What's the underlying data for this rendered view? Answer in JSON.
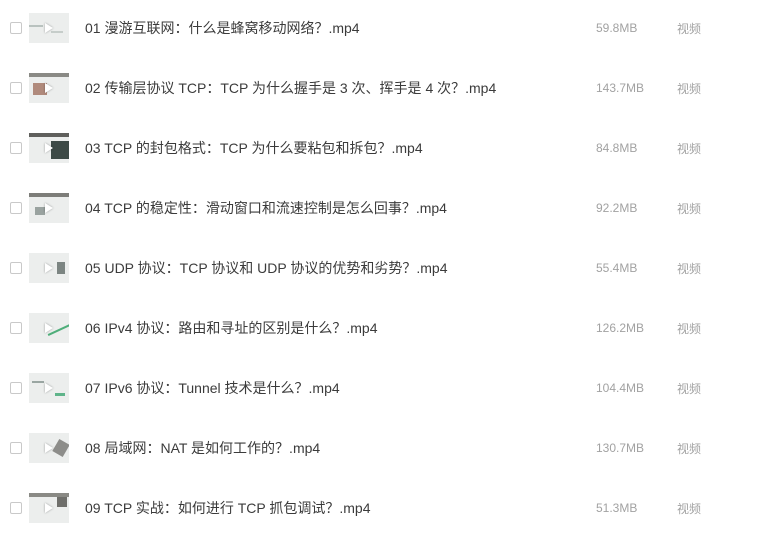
{
  "files": [
    {
      "title": "01 漫游互联网：什么是蜂窝移动网络？.mp4",
      "size": "59.8MB",
      "type": "视频"
    },
    {
      "title": "02 传输层协议 TCP：TCP 为什么握手是 3 次、挥手是 4 次？.mp4",
      "size": "143.7MB",
      "type": "视频"
    },
    {
      "title": "03 TCP 的封包格式：TCP 为什么要粘包和拆包？.mp4",
      "size": "84.8MB",
      "type": "视频"
    },
    {
      "title": "04 TCP 的稳定性：滑动窗口和流速控制是怎么回事？.mp4",
      "size": "92.2MB",
      "type": "视频"
    },
    {
      "title": "05 UDP 协议：TCP 协议和 UDP 协议的优势和劣势？.mp4",
      "size": "55.4MB",
      "type": "视频"
    },
    {
      "title": "06 IPv4 协议：路由和寻址的区别是什么？.mp4",
      "size": "126.2MB",
      "type": "视频"
    },
    {
      "title": "07 IPv6 协议：Tunnel 技术是什么？.mp4",
      "size": "104.4MB",
      "type": "视频"
    },
    {
      "title": "08 局域网：NAT 是如何工作的？.mp4",
      "size": "130.7MB",
      "type": "视频"
    },
    {
      "title": "09 TCP 实战：如何进行 TCP 抓包调试？.mp4",
      "size": "51.3MB",
      "type": "视频"
    }
  ],
  "colors": {
    "text": "#3b3b3b",
    "meta": "#a2a2a2",
    "checkbox_border": "#c9c9c9",
    "thumb_bg": "#eceeed"
  },
  "icons": {
    "thumbnail_overlay": "play-icon"
  }
}
